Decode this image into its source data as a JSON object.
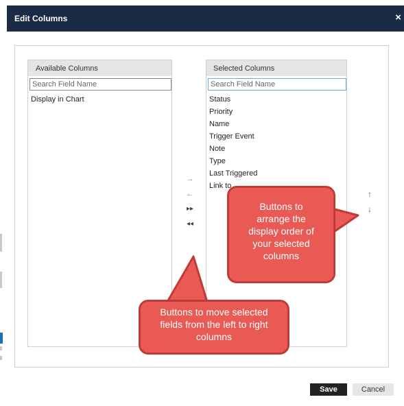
{
  "dialog": {
    "title": "Edit Columns",
    "close_glyph": "×"
  },
  "available": {
    "header": "Available Columns",
    "search_placeholder": "Search Field Name",
    "items": [
      "Display in Chart"
    ]
  },
  "selected": {
    "header": "Selected Columns",
    "search_placeholder": "Search Field Name",
    "items": [
      "Status",
      "Priority",
      "Name",
      "Trigger Event",
      "Note",
      "Type",
      "Last Triggered",
      "Link to"
    ]
  },
  "move_buttons": {
    "right": "→",
    "left": "←",
    "all_right": "▸▸",
    "all_left": "◂◂"
  },
  "order_buttons": {
    "up": "↑",
    "down": "↓"
  },
  "callouts": {
    "order_lines": [
      "Buttons to",
      "arrange the",
      "display order of",
      "your selected",
      "columns"
    ],
    "move_lines": [
      "Buttons to move selected",
      "fields from the left to right",
      "columns"
    ]
  },
  "footer": {
    "save_label": "Save",
    "cancel_label": "Cancel"
  },
  "colors": {
    "title_bar": "#1b2a45",
    "callout_fill": "#ea5a55",
    "callout_border": "#c03a36",
    "save_bg": "#222222"
  }
}
